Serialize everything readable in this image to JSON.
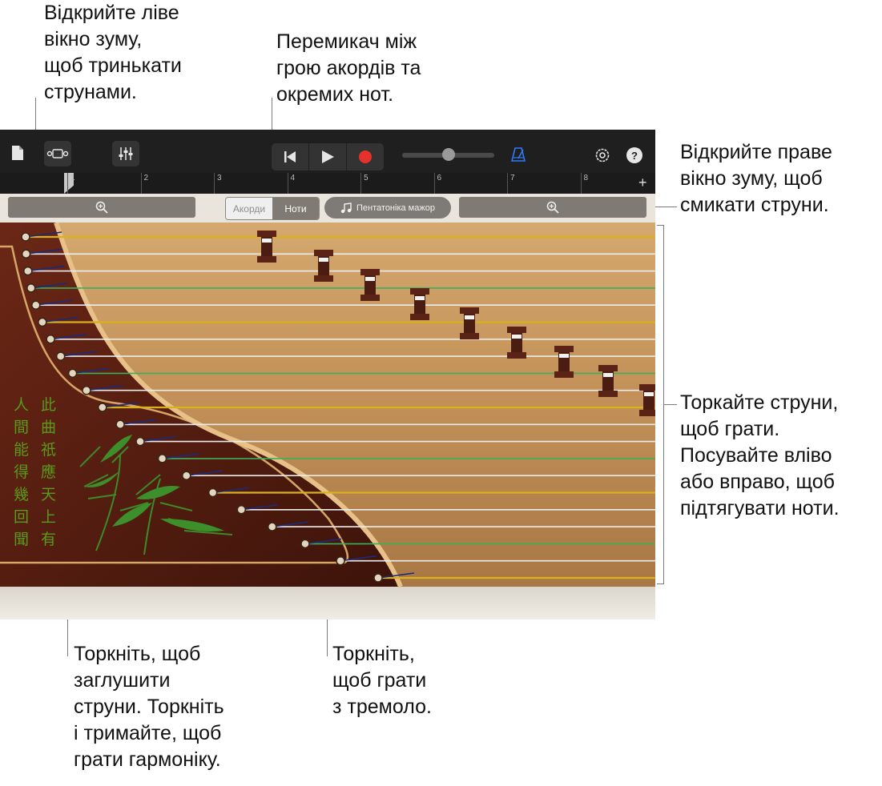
{
  "callouts": {
    "left_zoom": "Відкрийте ліве\nвікно зуму,\nщоб тринькати\nструнами.",
    "mode_switch": "Перемикач між\nгрою акордів та\nокремих нот.",
    "right_zoom": "Відкрийте праве\nвікно зуму, щоб\nсмикати струни.",
    "strings": "Торкайте струни,\nщоб грати.\nПосувайте вліво\nабо вправо, щоб\nпідтягувати ноти.",
    "mute": "Торкніть, щоб\nзаглушити\nструни. Торкніть\nі тримайте, щоб\nграти гармоніку.",
    "tremolo": "Торкніть,\nщоб грати\nз тремоло."
  },
  "toolbar": {
    "icons": [
      "document-icon",
      "view-toggle-icon",
      "mixer-icon",
      "rewind-icon",
      "play-icon",
      "record-icon",
      "metronome-icon",
      "settings-icon",
      "help-icon"
    ],
    "help_label": "?"
  },
  "ruler": {
    "marks": [
      "1",
      "2",
      "3",
      "4",
      "5",
      "6",
      "7",
      "8"
    ],
    "add_label": "+"
  },
  "controls": {
    "chords_label": "Акорди",
    "notes_label": "Ноти",
    "selected": "Ноти",
    "scale_label": "Пентатоніка мажор"
  },
  "instrument": {
    "poem_col1": "此曲祇應天上有",
    "poem_col2": "人間能得幾回聞"
  },
  "colors": {
    "accent_blue": "#2d7cf6",
    "record_red": "#e5322d",
    "wood_dark": "#5a1f12",
    "wood_light": "#c99a63",
    "string_gold": "#d9b21b",
    "string_green": "#3fae5a",
    "poem_green": "#5a9a1a"
  }
}
